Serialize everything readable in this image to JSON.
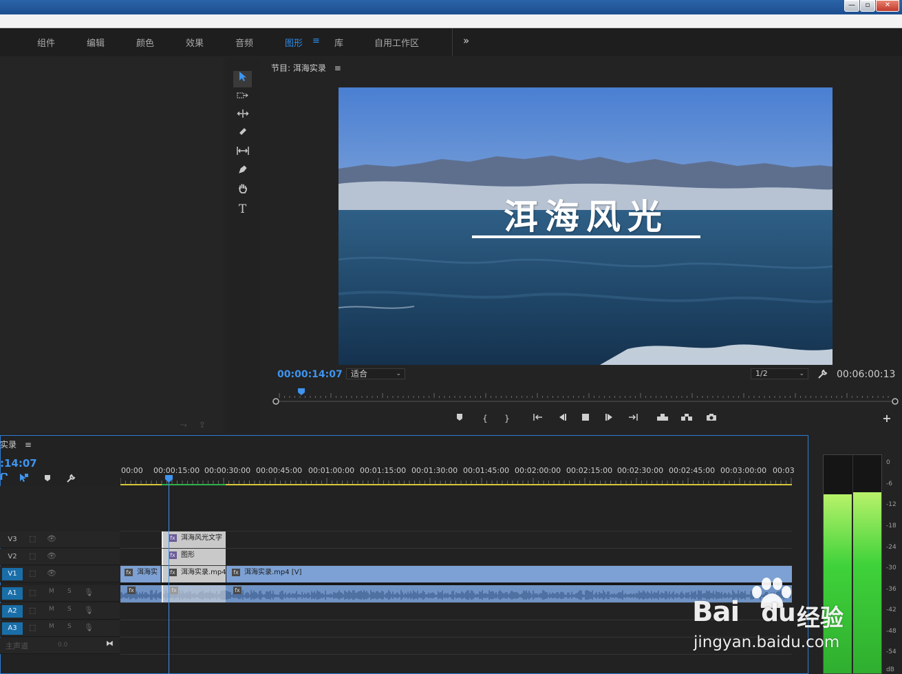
{
  "window": {
    "min_label": "—",
    "max_label": "▫",
    "close_label": "✕"
  },
  "menu": {
    "items": [
      "组件",
      "编辑",
      "颜色",
      "效果",
      "音频",
      "图形",
      "库",
      "自用工作区"
    ],
    "active_index": 5,
    "more": "»"
  },
  "program": {
    "title": "节目: 洱海实录",
    "menu_glyph": "≡",
    "overlay_title": "洱海风光",
    "current_time": "00:00:14:07",
    "zoom": "适合",
    "resolution": "1/2",
    "duration": "00:06:00:13",
    "playhead_fraction": 0.036
  },
  "tools": [
    "selection-tool",
    "track-select-tool",
    "ripple-edit-tool",
    "razor-tool",
    "slip-tool",
    "pen-tool",
    "hand-tool",
    "type-tool"
  ],
  "timeline": {
    "title": "实录",
    "menu_glyph": "≡",
    "current_time": ":14:07",
    "ruler": [
      "00:00",
      "00:00:15:00",
      "00:00:30:00",
      "00:00:45:00",
      "00:01:00:00",
      "00:01:15:00",
      "00:01:30:00",
      "00:01:45:00",
      "00:02:00:00",
      "00:02:15:00",
      "00:02:30:00",
      "00:02:45:00",
      "00:03:00:00",
      "00:03"
    ],
    "tracks": [
      {
        "id": "V3",
        "lock": "⬚",
        "toggle": "👁"
      },
      {
        "id": "V2",
        "lock": "⬚",
        "toggle": "👁"
      },
      {
        "id": "V1",
        "lock": "⬚",
        "toggle": "👁"
      },
      {
        "id": "A1",
        "m": "M",
        "s": "S"
      },
      {
        "id": "A2",
        "m": "M",
        "s": "S"
      },
      {
        "id": "A3",
        "m": "M",
        "s": "S"
      }
    ],
    "master_label": "主声道",
    "master_value": "0.0",
    "clips": {
      "v3_title": "洱海风光文字",
      "v2_graphic": "图形",
      "v1_a": "洱海实",
      "v1_b": "洱海实录.mp4",
      "v1_c": "洱海实录.mp4 [V]",
      "fx": "fx"
    }
  },
  "meter": {
    "labels": [
      "0",
      "-6",
      "-12",
      "-18",
      "-24",
      "-30",
      "-36",
      "-42",
      "-48",
      "-54",
      "dB"
    ],
    "left_level": 0.82,
    "right_level": 0.83
  },
  "watermark": {
    "brand": "Bai",
    "paw": "du",
    "cn": "经验",
    "url": "jingyan.baidu.com"
  },
  "colors": {
    "accent": "#2d8ceb",
    "clip_video": "#7da1d4",
    "clip_title": "#c9c9c9",
    "meter_green": "#3fd23a"
  }
}
